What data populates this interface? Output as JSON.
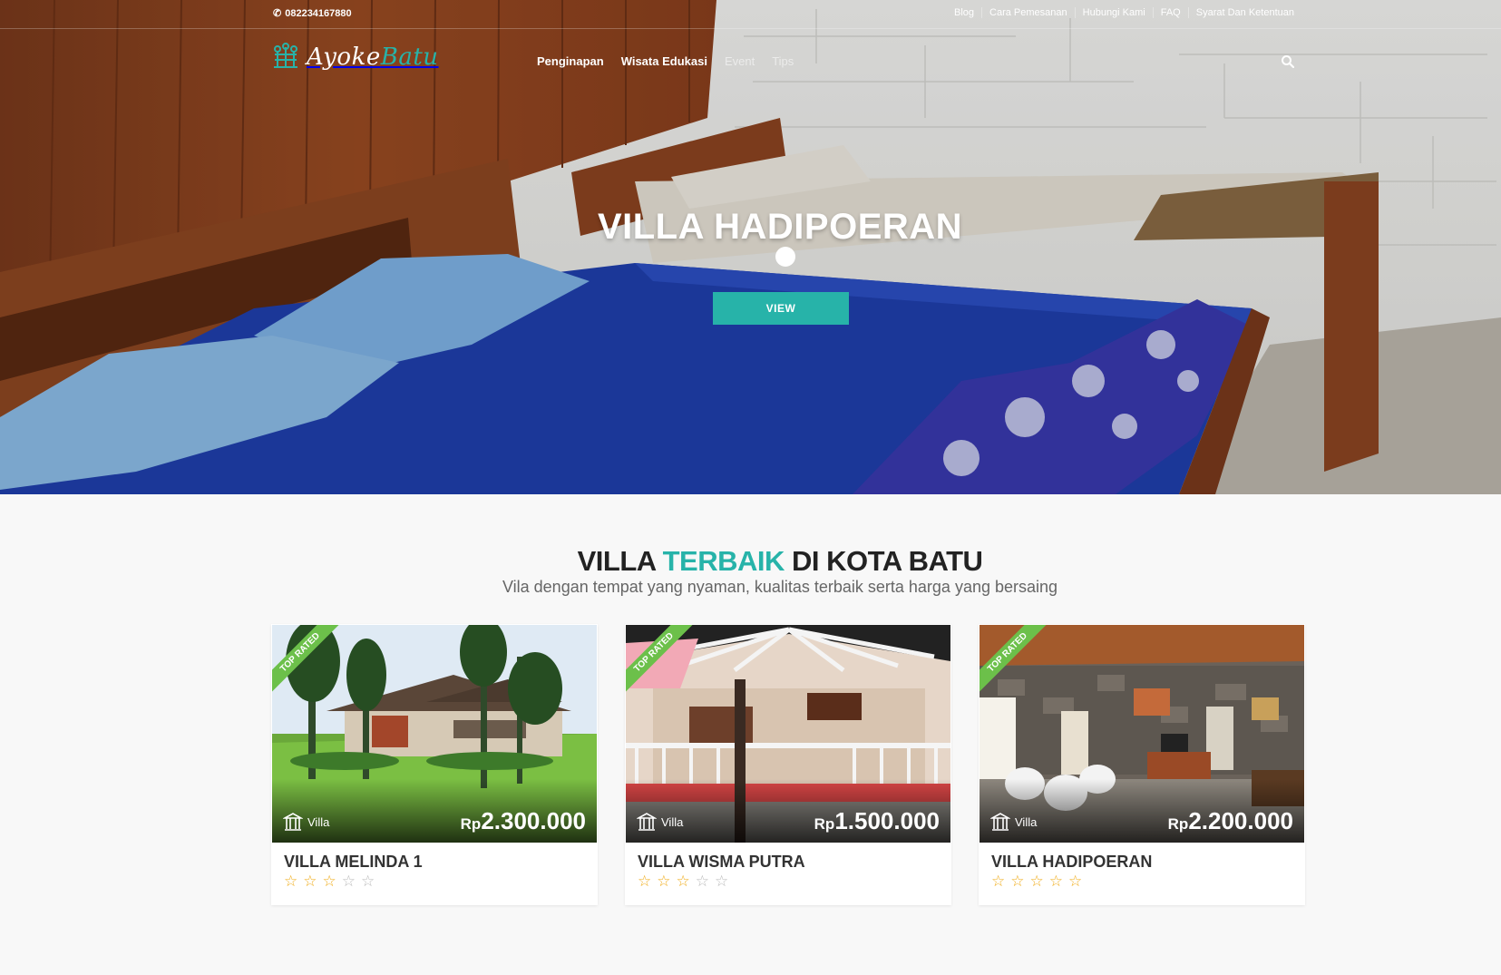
{
  "topbar": {
    "phone": "082234167880",
    "links": [
      "Blog",
      "Cara Pemesanan",
      "Hubungi Kami",
      "FAQ",
      "Syarat Dan Ketentuan"
    ]
  },
  "logo": {
    "part1": "Ayoke",
    "part2": "Batu"
  },
  "nav": {
    "items": [
      "Penginapan",
      "Wisata Edukasi",
      "Event",
      "Tips"
    ]
  },
  "hero": {
    "title": "VILLA HADIPOERAN",
    "button": "VIEW"
  },
  "section": {
    "title_a": "VILLA ",
    "title_hl": "TERBAIK",
    "title_b": " DI KOTA BATU",
    "subtitle": "Vila dengan tempat yang nyaman, kualitas terbaik serta harga yang bersaing"
  },
  "cards": [
    {
      "ribbon": "TOP RATED",
      "type": "Villa",
      "currency": "Rp",
      "price": "2.300.000",
      "name": "VILLA MELINDA 1",
      "rating": 0
    },
    {
      "ribbon": "TOP RATED",
      "type": "Villa",
      "currency": "Rp",
      "price": "1.500.000",
      "name": "VILLA WISMA PUTRA",
      "rating": 0
    },
    {
      "ribbon": "TOP RATED",
      "type": "Villa",
      "currency": "Rp",
      "price": "2.200.000",
      "name": "VILLA HADIPOERAN",
      "rating": 0
    }
  ],
  "colors": {
    "accent": "#27b3a9",
    "ribbon": "#6cc04a",
    "star": "#f0ad1c"
  }
}
